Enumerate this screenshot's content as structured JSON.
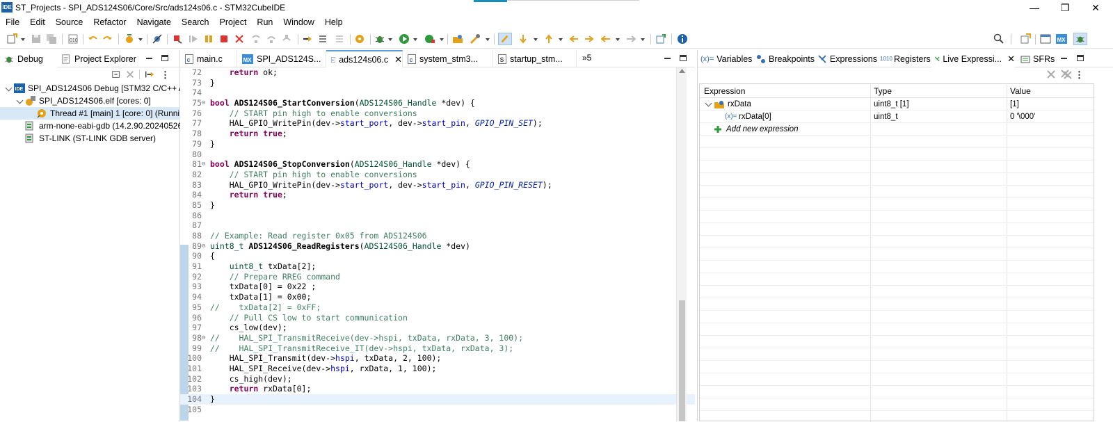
{
  "window": {
    "app_icon": "IDE",
    "title": "ST_Projects - SPI_ADS124S06/Core/Src/ads124s06.c - STM32CubeIDE",
    "minimize": "—",
    "maximize": "❐",
    "close": "✕"
  },
  "menu": [
    "File",
    "Edit",
    "Source",
    "Refactor",
    "Navigate",
    "Search",
    "Project",
    "Run",
    "Window",
    "Help"
  ],
  "left_panel": {
    "tabs": [
      {
        "label": "Debug",
        "icon": "debug-icon",
        "active": true
      },
      {
        "label": "Project Explorer",
        "icon": "project-explorer-icon",
        "active": false
      }
    ],
    "tree": [
      {
        "label": "SPI_ADS124S06 Debug [STM32 C/C++ Ap",
        "icon": "launch-config-icon",
        "level": 0,
        "expanded": true
      },
      {
        "label": "SPI_ADS124S06.elf [cores: 0]",
        "icon": "process-icon",
        "level": 1,
        "expanded": true
      },
      {
        "label": "Thread #1 [main] 1 [core: 0] (Runni",
        "icon": "thread-icon",
        "level": 2,
        "selected": true
      },
      {
        "label": "arm-none-eabi-gdb (14.2.90.20240526",
        "icon": "gdb-icon",
        "level": 1
      },
      {
        "label": "ST-LINK (ST-LINK GDB server)",
        "icon": "gdb-server-icon",
        "level": 1
      }
    ]
  },
  "editor": {
    "tabs": [
      {
        "label": "main.c",
        "icon": "c-file-icon",
        "active": false
      },
      {
        "label": "SPI_ADS124S...",
        "icon": "mx-icon",
        "active": false
      },
      {
        "label": "ads124s06.c",
        "icon": "c-file-icon",
        "active": true,
        "closable": true
      },
      {
        "label": "system_stm3...",
        "icon": "c-file-icon",
        "active": false
      },
      {
        "label": "startup_stm...",
        "icon": "asm-file-icon",
        "active": false
      }
    ],
    "overflow": "»5",
    "lines": [
      {
        "n": "72",
        "t": "    return ok;"
      },
      {
        "n": "73",
        "t": "}"
      },
      {
        "n": "74",
        "t": ""
      },
      {
        "n": "75",
        "fold": true,
        "t": "bool ADS124S06_StartConversion(ADS124S06_Handle *dev) {"
      },
      {
        "n": "76",
        "t": "    // START pin high to enable conversions"
      },
      {
        "n": "77",
        "t": "    HAL_GPIO_WritePin(dev->start_port, dev->start_pin, GPIO_PIN_SET);"
      },
      {
        "n": "78",
        "t": "    return true;"
      },
      {
        "n": "79",
        "t": "}"
      },
      {
        "n": "80",
        "t": ""
      },
      {
        "n": "81",
        "fold": true,
        "t": "bool ADS124S06_StopConversion(ADS124S06_Handle *dev) {"
      },
      {
        "n": "82",
        "t": "    // START pin high to enable conversions"
      },
      {
        "n": "83",
        "t": "    HAL_GPIO_WritePin(dev->start_port, dev->start_pin, GPIO_PIN_RESET);"
      },
      {
        "n": "84",
        "t": "    return true;"
      },
      {
        "n": "85",
        "t": "}"
      },
      {
        "n": "86",
        "t": ""
      },
      {
        "n": "87",
        "t": ""
      },
      {
        "n": "88",
        "t": "// Example: Read register 0x05 from ADS124S06"
      },
      {
        "n": "89",
        "fold": true,
        "t": "uint8_t ADS124S06_ReadRegisters(ADS124S06_Handle *dev)"
      },
      {
        "n": "90",
        "t": "{"
      },
      {
        "n": "91",
        "t": "    uint8_t txData[2];"
      },
      {
        "n": "92",
        "t": "    // Prepare RREG command"
      },
      {
        "n": "93",
        "t": "    txData[0] = 0x22 ;"
      },
      {
        "n": "94",
        "t": "    txData[1] = 0x00;"
      },
      {
        "n": "95",
        "t": "//    txData[2] = 0xFF;"
      },
      {
        "n": "96",
        "t": "    // Pull CS low to start communication"
      },
      {
        "n": "97",
        "t": "    cs_low(dev);"
      },
      {
        "n": "98",
        "fold": true,
        "t": "//    HAL_SPI_TransmitReceive(dev->hspi, txData, rxData, 3, 100);"
      },
      {
        "n": "99",
        "t": "//    HAL_SPI_TransmitReceive_IT(dev->hspi, txData, rxData, 3);"
      },
      {
        "n": "100",
        "t": "    HAL_SPI_Transmit(dev->hspi, txData, 2, 100);"
      },
      {
        "n": "101",
        "t": "    HAL_SPI_Receive(dev->hspi, rxData, 1, 100);"
      },
      {
        "n": "102",
        "t": "    cs_high(dev);"
      },
      {
        "n": "103",
        "t": "    return rxData[0];"
      },
      {
        "n": "104",
        "t": "}",
        "highlight": true
      },
      {
        "n": "105",
        "t": ""
      }
    ]
  },
  "right_panel": {
    "tabs": [
      {
        "label": "Variables",
        "icon": "variables-icon",
        "prefix": "(x)="
      },
      {
        "label": "Breakpoints",
        "icon": "breakpoints-icon"
      },
      {
        "label": "Expressions",
        "icon": "expressions-icon"
      },
      {
        "label": "Registers",
        "icon": "registers-icon",
        "prefix": "1010"
      },
      {
        "label": "Live Expressi...",
        "icon": "live-expressions-icon",
        "active": true,
        "closable": true
      },
      {
        "label": "SFRs",
        "icon": "sfrs-icon"
      }
    ],
    "columns": [
      "Expression",
      "Type",
      "Value"
    ],
    "rows": [
      {
        "expression": "rxData",
        "type": "uint8_t [1]",
        "value": "[1]",
        "expanded": true
      },
      {
        "expression": "rxData[0]",
        "prefix": "(x)=",
        "type": "uint8_t",
        "value": "0 '\\000'"
      }
    ],
    "add_new": "Add new expression"
  },
  "colors": {
    "keyword": "#7f0055",
    "comment": "#3f7f5f",
    "type": "#005032",
    "field": "#0000c0",
    "selection": "#d9e8f7"
  }
}
